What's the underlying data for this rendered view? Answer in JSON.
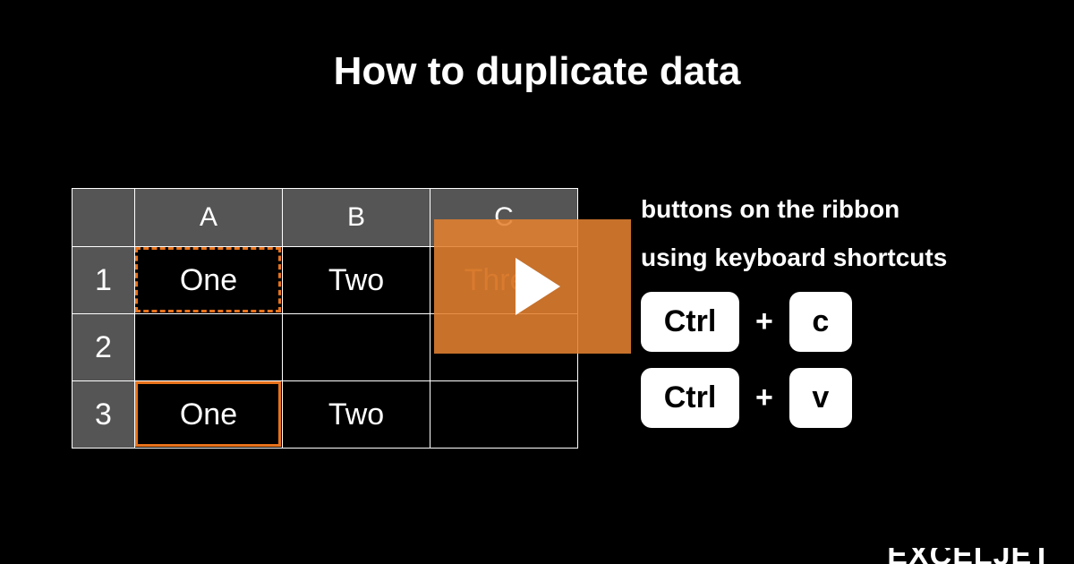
{
  "title": "How to duplicate data",
  "grid": {
    "columns": [
      "A",
      "B",
      "C"
    ],
    "rows": [
      "1",
      "2",
      "3"
    ],
    "cells": {
      "r1c1": "One",
      "r1c2": "Two",
      "r1c3": "Three",
      "r2c1": "",
      "r2c2": "",
      "r2c3": "",
      "r3c1": "One",
      "r3c2": "Two",
      "r3c3": ""
    },
    "marquee_cell": "A1",
    "selected_cell": "A3"
  },
  "tips": {
    "line1": "buttons on the ribbon",
    "line2": "using keyboard shortcuts"
  },
  "shortcuts": {
    "copy": {
      "mod": "Ctrl",
      "plus": "+",
      "key": "c"
    },
    "paste": {
      "mod": "Ctrl",
      "plus": "+",
      "key": "v"
    }
  },
  "brand": "EXCELJET"
}
